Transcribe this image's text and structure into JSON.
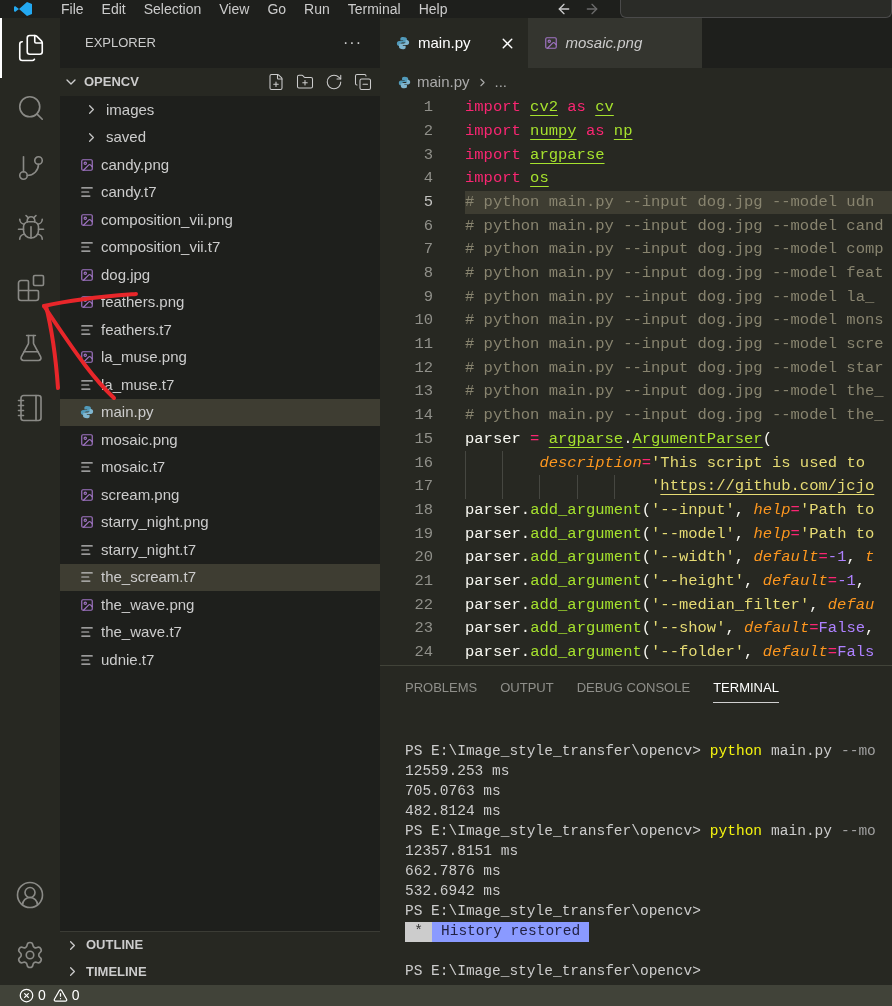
{
  "menu": [
    "File",
    "Edit",
    "Selection",
    "View",
    "Go",
    "Run",
    "Terminal",
    "Help"
  ],
  "activity_bar": [
    {
      "kind": "explorer",
      "selected": true
    },
    {
      "kind": "search",
      "selected": false
    },
    {
      "kind": "source-control",
      "selected": false
    },
    {
      "kind": "run-debug",
      "selected": false
    },
    {
      "kind": "extensions",
      "selected": false
    },
    {
      "kind": "testing",
      "selected": false
    },
    {
      "kind": "notebook",
      "selected": false
    }
  ],
  "activity_bar_bottom": [
    {
      "kind": "account"
    },
    {
      "kind": "settings"
    }
  ],
  "sidebar": {
    "title": "EXPLORER",
    "more": "···",
    "folder": "OPENCV",
    "files": [
      {
        "name": "images",
        "kind": "folder",
        "selected": false
      },
      {
        "name": "saved",
        "kind": "folder",
        "selected": false
      },
      {
        "name": "candy.png",
        "kind": "image",
        "selected": false
      },
      {
        "name": "candy.t7",
        "kind": "text",
        "selected": false
      },
      {
        "name": "composition_vii.png",
        "kind": "image",
        "selected": false
      },
      {
        "name": "composition_vii.t7",
        "kind": "text",
        "selected": false
      },
      {
        "name": "dog.jpg",
        "kind": "image",
        "selected": false
      },
      {
        "name": "feathers.png",
        "kind": "image",
        "selected": false
      },
      {
        "name": "feathers.t7",
        "kind": "text",
        "selected": false
      },
      {
        "name": "la_muse.png",
        "kind": "image",
        "selected": false
      },
      {
        "name": "la_muse.t7",
        "kind": "text",
        "selected": false
      },
      {
        "name": "main.py",
        "kind": "python",
        "selected": true
      },
      {
        "name": "mosaic.png",
        "kind": "image",
        "selected": false
      },
      {
        "name": "mosaic.t7",
        "kind": "text",
        "selected": false
      },
      {
        "name": "scream.png",
        "kind": "image",
        "selected": false
      },
      {
        "name": "starry_night.png",
        "kind": "image",
        "selected": false
      },
      {
        "name": "starry_night.t7",
        "kind": "text",
        "selected": false
      },
      {
        "name": "the_scream.t7",
        "kind": "text",
        "selected": true
      },
      {
        "name": "the_wave.png",
        "kind": "image",
        "selected": false
      },
      {
        "name": "the_wave.t7",
        "kind": "text",
        "selected": false
      },
      {
        "name": "udnie.t7",
        "kind": "text",
        "selected": false
      }
    ],
    "sections": [
      "OUTLINE",
      "TIMELINE"
    ]
  },
  "tabs": [
    {
      "label": "main.py",
      "kind": "python",
      "selected": true,
      "preview": false
    },
    {
      "label": "mosaic.png",
      "kind": "image",
      "selected": false,
      "preview": true
    }
  ],
  "breadcrumb": {
    "file": "main.py",
    "rest": "..."
  },
  "code": [
    {
      "number": "1",
      "current": false,
      "tokens": [
        {
          "kind": "kw",
          "text": "import"
        },
        {
          "kind": "mod",
          "text": "cv2",
          "space": true
        },
        {
          "kind": "kw",
          "text": "as",
          "space": true
        },
        {
          "kind": "mod",
          "text": "cv",
          "space": true
        }
      ]
    },
    {
      "number": "2",
      "current": false,
      "tokens": [
        {
          "kind": "kw",
          "text": "import"
        },
        {
          "kind": "mod",
          "text": "numpy",
          "space": true
        },
        {
          "kind": "kw",
          "text": "as",
          "space": true
        },
        {
          "kind": "mod",
          "text": "np",
          "space": true
        }
      ]
    },
    {
      "number": "3",
      "current": false,
      "tokens": [
        {
          "kind": "kw",
          "text": "import"
        },
        {
          "kind": "mod",
          "text": "argparse",
          "space": true
        }
      ]
    },
    {
      "number": "4",
      "current": false,
      "tokens": [
        {
          "kind": "kw",
          "text": "import"
        },
        {
          "kind": "mod",
          "text": "os",
          "space": true
        }
      ]
    },
    {
      "number": "5",
      "current": true,
      "tokens": [
        {
          "kind": "cm",
          "text": "# python main.py --input dog.jpg --model udn"
        }
      ]
    },
    {
      "number": "6",
      "current": false,
      "tokens": [
        {
          "kind": "cm",
          "text": "# python main.py --input dog.jpg --model cand"
        }
      ]
    },
    {
      "number": "7",
      "current": false,
      "tokens": [
        {
          "kind": "cm",
          "text": "# python main.py --input dog.jpg --model comp"
        }
      ]
    },
    {
      "number": "8",
      "current": false,
      "tokens": [
        {
          "kind": "cm",
          "text": "# python main.py --input dog.jpg --model feat"
        }
      ]
    },
    {
      "number": "9",
      "current": false,
      "tokens": [
        {
          "kind": "cm",
          "text": "# python main.py --input dog.jpg --model la_"
        }
      ]
    },
    {
      "number": "10",
      "current": false,
      "tokens": [
        {
          "kind": "cm",
          "text": "# python main.py --input dog.jpg --model mons"
        }
      ]
    },
    {
      "number": "11",
      "current": false,
      "tokens": [
        {
          "kind": "cm",
          "text": "# python main.py --input dog.jpg --model scre"
        }
      ]
    },
    {
      "number": "12",
      "current": false,
      "tokens": [
        {
          "kind": "cm",
          "text": "# python main.py --input dog.jpg --model star"
        }
      ]
    },
    {
      "number": "13",
      "current": false,
      "tokens": [
        {
          "kind": "cm",
          "text": "# python main.py --input dog.jpg --model the_"
        }
      ]
    },
    {
      "number": "14",
      "current": false,
      "tokens": [
        {
          "kind": "cm",
          "text": "# python main.py --input dog.jpg --model the_"
        }
      ]
    },
    {
      "number": "15",
      "current": false,
      "tokens": [
        {
          "kind": "p",
          "text": "parser"
        },
        {
          "kind": "op",
          "text": "=",
          "space": true
        },
        {
          "kind": "mod",
          "text": "argparse",
          "space": true
        },
        {
          "kind": "p",
          "text": "."
        },
        {
          "kind": "mod",
          "text": "ArgumentParser"
        },
        {
          "kind": "br",
          "text": "("
        }
      ]
    },
    {
      "number": "16",
      "current": false,
      "hanging": true,
      "tokens": [
        {
          "kind": "par",
          "text": "description"
        },
        {
          "kind": "op",
          "text": "="
        },
        {
          "kind": "str",
          "text": "'This script is used to"
        }
      ]
    },
    {
      "number": "17",
      "current": false,
      "aligned": true,
      "tokens": [
        {
          "kind": "str",
          "text": "'"
        },
        {
          "kind": "link",
          "text": "https://github.com/jcjo"
        }
      ]
    },
    {
      "number": "18",
      "current": false,
      "tokens": [
        {
          "kind": "p",
          "text": "parser."
        },
        {
          "kind": "fn",
          "text": "add_argument"
        },
        {
          "kind": "br",
          "text": "("
        },
        {
          "kind": "str",
          "text": "'--input'"
        },
        {
          "kind": "p",
          "text": ","
        },
        {
          "kind": "par",
          "text": "help",
          "space": true
        },
        {
          "kind": "op",
          "text": "="
        },
        {
          "kind": "str",
          "text": "'Path to"
        }
      ]
    },
    {
      "number": "19",
      "current": false,
      "tokens": [
        {
          "kind": "p",
          "text": "parser."
        },
        {
          "kind": "fn",
          "text": "add_argument"
        },
        {
          "kind": "br",
          "text": "("
        },
        {
          "kind": "str",
          "text": "'--model'"
        },
        {
          "kind": "p",
          "text": ","
        },
        {
          "kind": "par",
          "text": "help",
          "space": true
        },
        {
          "kind": "op",
          "text": "="
        },
        {
          "kind": "str",
          "text": "'Path to"
        }
      ]
    },
    {
      "number": "20",
      "current": false,
      "tokens": [
        {
          "kind": "p",
          "text": "parser."
        },
        {
          "kind": "fn",
          "text": "add_argument"
        },
        {
          "kind": "br",
          "text": "("
        },
        {
          "kind": "str",
          "text": "'--width'"
        },
        {
          "kind": "p",
          "text": ","
        },
        {
          "kind": "par",
          "text": "default",
          "space": true
        },
        {
          "kind": "op",
          "text": "="
        },
        {
          "kind": "num",
          "text": "-1"
        },
        {
          "kind": "p",
          "text": ","
        },
        {
          "kind": "par",
          "text": "t",
          "space": true
        }
      ]
    },
    {
      "number": "21",
      "current": false,
      "tokens": [
        {
          "kind": "p",
          "text": "parser."
        },
        {
          "kind": "fn",
          "text": "add_argument"
        },
        {
          "kind": "br",
          "text": "("
        },
        {
          "kind": "str",
          "text": "'--height'"
        },
        {
          "kind": "p",
          "text": ","
        },
        {
          "kind": "par",
          "text": "default",
          "space": true
        },
        {
          "kind": "op",
          "text": "="
        },
        {
          "kind": "num",
          "text": "-1"
        },
        {
          "kind": "p",
          "text": ","
        }
      ]
    },
    {
      "number": "22",
      "current": false,
      "tokens": [
        {
          "kind": "p",
          "text": "parser."
        },
        {
          "kind": "fn",
          "text": "add_argument"
        },
        {
          "kind": "br",
          "text": "("
        },
        {
          "kind": "str",
          "text": "'--median_filter'"
        },
        {
          "kind": "p",
          "text": ","
        },
        {
          "kind": "par",
          "text": "defau",
          "space": true
        }
      ]
    },
    {
      "number": "23",
      "current": false,
      "tokens": [
        {
          "kind": "p",
          "text": "parser."
        },
        {
          "kind": "fn",
          "text": "add_argument"
        },
        {
          "kind": "br",
          "text": "("
        },
        {
          "kind": "str",
          "text": "'--show'"
        },
        {
          "kind": "p",
          "text": ","
        },
        {
          "kind": "par",
          "text": "default",
          "space": true
        },
        {
          "kind": "op",
          "text": "="
        },
        {
          "kind": "num",
          "text": "False"
        },
        {
          "kind": "p",
          "text": ","
        }
      ]
    },
    {
      "number": "24",
      "current": false,
      "tokens": [
        {
          "kind": "p",
          "text": "parser."
        },
        {
          "kind": "fn",
          "text": "add_argument"
        },
        {
          "kind": "br",
          "text": "("
        },
        {
          "kind": "str",
          "text": "'--folder'"
        },
        {
          "kind": "p",
          "text": ","
        },
        {
          "kind": "par",
          "text": "default",
          "space": true
        },
        {
          "kind": "op",
          "text": "="
        },
        {
          "kind": "num",
          "text": "Fals"
        }
      ]
    }
  ],
  "panel_tabs": [
    {
      "label": "PROBLEMS",
      "selected": false
    },
    {
      "label": "OUTPUT",
      "selected": false
    },
    {
      "label": "DEBUG CONSOLE",
      "selected": false
    },
    {
      "label": "TERMINAL",
      "selected": true
    }
  ],
  "terminal": [
    {
      "kind": "blank"
    },
    {
      "kind": "command",
      "prompt": "PS E:\\Image_style_transfer\\opencv>",
      "program": "python",
      "args": "main.py",
      "flag": "--mo"
    },
    {
      "kind": "output",
      "text": "12559.253 ms"
    },
    {
      "kind": "output",
      "text": "705.0763 ms"
    },
    {
      "kind": "output",
      "text": "482.8124 ms"
    },
    {
      "kind": "command",
      "prompt": "PS E:\\Image_style_transfer\\opencv>",
      "program": "python",
      "args": "main.py",
      "flag": "--mo"
    },
    {
      "kind": "output",
      "text": "12357.8151 ms"
    },
    {
      "kind": "output",
      "text": "662.7876 ms"
    },
    {
      "kind": "output",
      "text": "532.6942 ms"
    },
    {
      "kind": "output",
      "text": "PS E:\\Image_style_transfer\\opencv>"
    },
    {
      "kind": "notice",
      "mark": "*",
      "text": "History restored"
    },
    {
      "kind": "blank"
    },
    {
      "kind": "output",
      "text": "PS E:\\Image_style_transfer\\opencv>"
    }
  ],
  "status_bar": {
    "errors": "0",
    "warnings": "0"
  }
}
